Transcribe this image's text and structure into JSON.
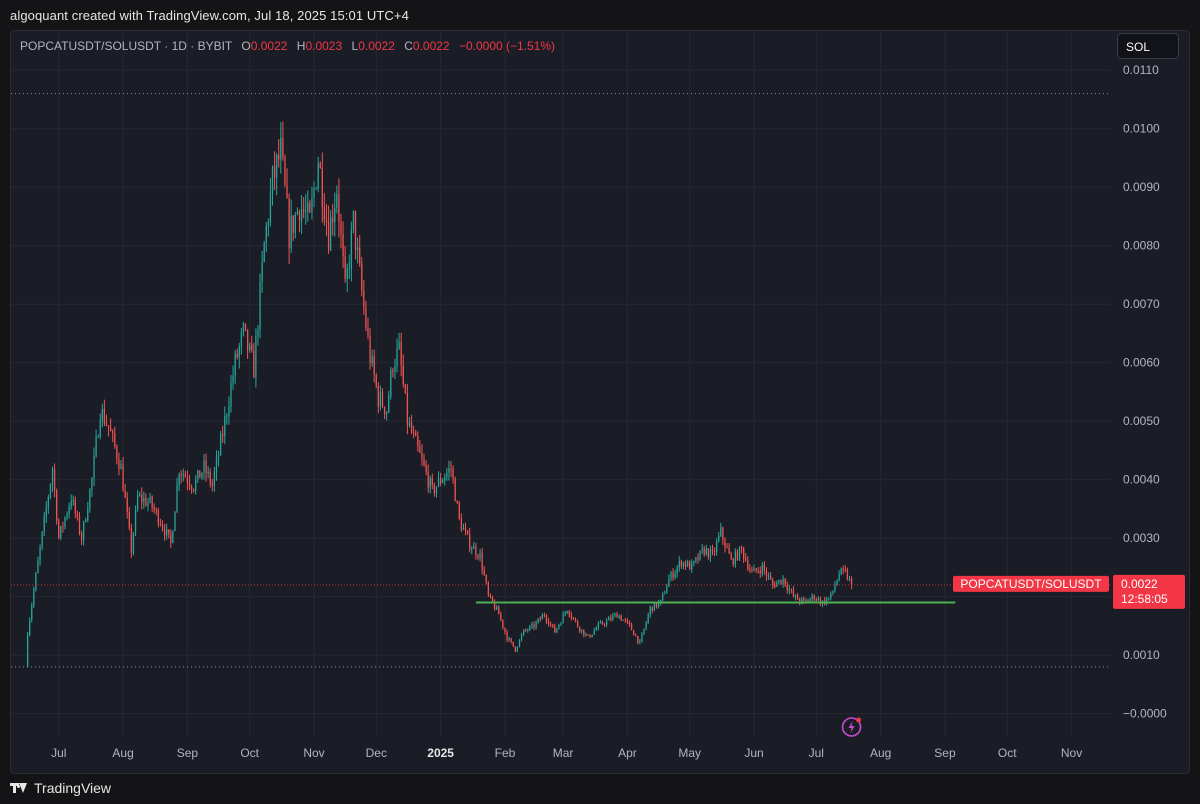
{
  "header": {
    "credit": "algoquant created with TradingView.com, Jul 18, 2025 15:01 UTC+4"
  },
  "legend": {
    "symbol": "POPCATUSDT/SOLUSDT · 1D · BYBIT",
    "o_label": "O",
    "o": "0.0022",
    "h_label": "H",
    "h": "0.0023",
    "l_label": "L",
    "l": "0.0022",
    "c_label": "C",
    "c": "0.0022",
    "change": "−0.0000 (−1.51%)"
  },
  "symbol_button": "SOL",
  "footer": {
    "brand": "TradingView"
  },
  "colors": {
    "up": "#26a69a",
    "down": "#ef5350",
    "background": "#1b1d26",
    "grid": "#252833",
    "support_line": "#4caf50",
    "price_tag": "#f23645",
    "dotted_line": "#8b8f9a"
  },
  "icons": [
    "lightning-icon",
    "tradingview-logo-icon"
  ],
  "chart_data": {
    "type": "candlestick",
    "interval": "1D",
    "exchange": "BYBIT",
    "y_ticks": [
      "0.0110",
      "0.0100",
      "0.0090",
      "0.0080",
      "0.0070",
      "0.0060",
      "0.0050",
      "0.0040",
      "0.0030",
      "0.0020",
      "0.0010",
      "−0.0000"
    ],
    "y_range": [
      -0.0004,
      0.0115
    ],
    "x_ticks": [
      {
        "label": "Jul",
        "date": "2024-07-01"
      },
      {
        "label": "Aug",
        "date": "2024-08-01"
      },
      {
        "label": "Sep",
        "date": "2024-09-01"
      },
      {
        "label": "Oct",
        "date": "2024-10-01"
      },
      {
        "label": "Nov",
        "date": "2024-11-01"
      },
      {
        "label": "Dec",
        "date": "2024-12-01"
      },
      {
        "label": "2025",
        "date": "2025-01-01",
        "bold": true
      },
      {
        "label": "Feb",
        "date": "2025-02-01"
      },
      {
        "label": "Mar",
        "date": "2025-03-01"
      },
      {
        "label": "Apr",
        "date": "2025-04-01"
      },
      {
        "label": "May",
        "date": "2025-05-01"
      },
      {
        "label": "Jun",
        "date": "2025-06-01"
      },
      {
        "label": "Jul",
        "date": "2025-07-01"
      },
      {
        "label": "Aug",
        "date": "2025-08-01"
      },
      {
        "label": "Sep",
        "date": "2025-09-01"
      },
      {
        "label": "Oct",
        "date": "2025-10-01"
      },
      {
        "label": "Nov",
        "date": "2025-11-01"
      }
    ],
    "x_range": [
      "2024-06-08",
      "2025-11-20"
    ],
    "start_date": "2024-06-16",
    "end_date": "2025-07-18",
    "close_path": [
      [
        "2024-06-16",
        0.0014
      ],
      [
        "2024-06-20",
        0.00235
      ],
      [
        "2024-06-28",
        0.0042
      ],
      [
        "2024-07-01",
        0.003
      ],
      [
        "2024-07-07",
        0.0037
      ],
      [
        "2024-07-12",
        0.003
      ],
      [
        "2024-07-17",
        0.004
      ],
      [
        "2024-07-21",
        0.0052
      ],
      [
        "2024-07-25",
        0.0049
      ],
      [
        "2024-07-31",
        0.0042
      ],
      [
        "2024-08-05",
        0.0028
      ],
      [
        "2024-08-08",
        0.0037
      ],
      [
        "2024-08-14",
        0.0036
      ],
      [
        "2024-08-19",
        0.0033
      ],
      [
        "2024-08-24",
        0.0029
      ],
      [
        "2024-08-28",
        0.0042
      ],
      [
        "2024-09-04",
        0.0039
      ],
      [
        "2024-09-09",
        0.0042
      ],
      [
        "2024-09-13",
        0.0039
      ],
      [
        "2024-09-18",
        0.0048
      ],
      [
        "2024-09-24",
        0.006
      ],
      [
        "2024-09-28",
        0.0065
      ],
      [
        "2024-10-03",
        0.0059
      ],
      [
        "2024-10-08",
        0.008
      ],
      [
        "2024-10-12",
        0.0091
      ],
      [
        "2024-10-16",
        0.0096
      ],
      [
        "2024-10-20",
        0.0082
      ],
      [
        "2024-10-25",
        0.0087
      ],
      [
        "2024-10-30",
        0.0084
      ],
      [
        "2024-11-03",
        0.0095
      ],
      [
        "2024-11-08",
        0.0082
      ],
      [
        "2024-11-12",
        0.009
      ],
      [
        "2024-11-16",
        0.0072
      ],
      [
        "2024-11-20",
        0.0084
      ],
      [
        "2024-11-24",
        0.0072
      ],
      [
        "2024-11-28",
        0.0061
      ],
      [
        "2024-12-02",
        0.0054
      ],
      [
        "2024-12-06",
        0.0052
      ],
      [
        "2024-12-09",
        0.006
      ],
      [
        "2024-12-12",
        0.0062
      ],
      [
        "2024-12-16",
        0.005
      ],
      [
        "2024-12-20",
        0.0046
      ],
      [
        "2024-12-24",
        0.0042
      ],
      [
        "2024-12-28",
        0.0038
      ],
      [
        "2025-01-01",
        0.004
      ],
      [
        "2025-01-06",
        0.0042
      ],
      [
        "2025-01-10",
        0.0033
      ],
      [
        "2025-01-15",
        0.0029
      ],
      [
        "2025-01-20",
        0.0027
      ],
      [
        "2025-01-24",
        0.002
      ],
      [
        "2025-01-29",
        0.0017
      ],
      [
        "2025-02-02",
        0.0013
      ],
      [
        "2025-02-06",
        0.0011
      ],
      [
        "2025-02-10",
        0.0014
      ],
      [
        "2025-02-15",
        0.0015
      ],
      [
        "2025-02-20",
        0.0017
      ],
      [
        "2025-02-25",
        0.0014
      ],
      [
        "2025-03-03",
        0.0018
      ],
      [
        "2025-03-08",
        0.0015
      ],
      [
        "2025-03-13",
        0.0013
      ],
      [
        "2025-03-18",
        0.0015
      ],
      [
        "2025-03-23",
        0.0016
      ],
      [
        "2025-03-27",
        0.0017
      ],
      [
        "2025-04-02",
        0.0015
      ],
      [
        "2025-04-07",
        0.0012
      ],
      [
        "2025-04-12",
        0.0018
      ],
      [
        "2025-04-17",
        0.0019
      ],
      [
        "2025-04-21",
        0.0023
      ],
      [
        "2025-04-27",
        0.0026
      ],
      [
        "2025-05-02",
        0.0025
      ],
      [
        "2025-05-08",
        0.0028
      ],
      [
        "2025-05-12",
        0.0027
      ],
      [
        "2025-05-16",
        0.0031
      ],
      [
        "2025-05-21",
        0.0026
      ],
      [
        "2025-05-26",
        0.0028
      ],
      [
        "2025-05-31",
        0.0024
      ],
      [
        "2025-06-05",
        0.0025
      ],
      [
        "2025-06-10",
        0.0022
      ],
      [
        "2025-06-15",
        0.0023
      ],
      [
        "2025-06-20",
        0.002
      ],
      [
        "2025-06-25",
        0.0019
      ],
      [
        "2025-06-30",
        0.002
      ],
      [
        "2025-07-04",
        0.0019
      ],
      [
        "2025-07-08",
        0.002
      ],
      [
        "2025-07-12",
        0.0024
      ],
      [
        "2025-07-15",
        0.0024
      ],
      [
        "2025-07-18",
        0.0022
      ]
    ],
    "period_high": 0.0106,
    "period_low": 0.0008,
    "last_price": "0.0022",
    "last_price_value": 0.0022,
    "countdown": "12:58:05",
    "price_tag_label": "POPCATUSDT/SOLUSDT",
    "support_line": {
      "value": 0.0019,
      "from": "2025-01-18",
      "to": "2025-09-06",
      "color": "#4caf50"
    }
  }
}
